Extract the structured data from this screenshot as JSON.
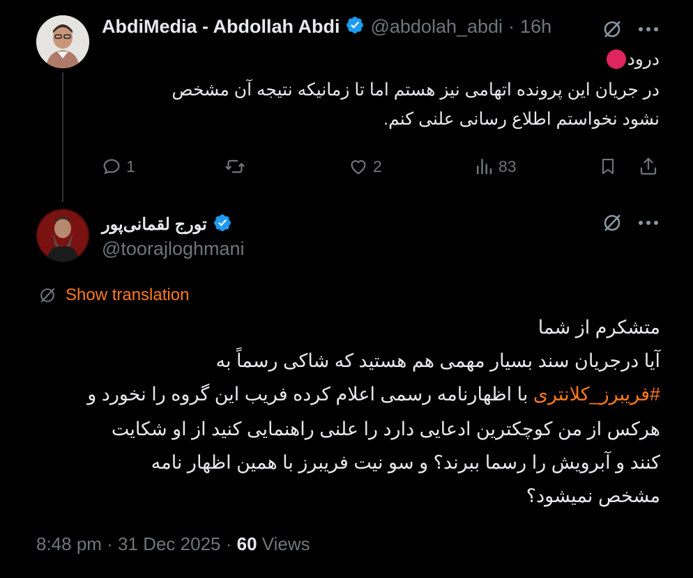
{
  "reply_tweet": {
    "display_name": "AbdiMedia - Abdollah Abdi",
    "handle": "@abdolah_abdi",
    "separator": "·",
    "time": "16h",
    "greeting": "درود",
    "body_line1": "در جریان این پرونده اتهامی نیز هستم اما تا زمانیکه نتیجه آن مشخص",
    "body_line2": "نشود نخواستم  اطلاع رسانی علنی کنم.",
    "replies": "1",
    "reposts": "",
    "likes": "2",
    "views": "83"
  },
  "main_tweet": {
    "display_name": "تورج لقمانی‌پور",
    "handle": "@toorajloghmani",
    "show_translation": "Show translation",
    "line1": "متشکرم از شما",
    "line2": "آیا درجریان سند بسیار مهمی هم هستید که شاکی رسماً به",
    "line3_hashtag": "#فریبرز_کلانتری",
    "line3_rest": " با اظهارنامه رسمی اعلام کرده فریب این گروه را نخورد و",
    "line4": "هرکس از من کوچکترین ادعایی دارد را علنی  راهنمایی کنید از او شکایت",
    "line5": "کنند و آبرویش را رسما ببرند؟ و سو نیت فریبرز با همین اظهار نامه",
    "line6": "مشخص نمیشود؟",
    "timestamp": "8:48 pm · 31 Dec 2025 · ",
    "views_count": "60",
    "views_label": " Views"
  },
  "colors": {
    "background": "#000000",
    "text": "#e7e9ea",
    "muted": "#71767b",
    "accent": "#ff7a1a",
    "verified": "#1d9bf0",
    "greeting_dot": "#e0245e"
  },
  "icons": [
    "grok-icon",
    "more-icon",
    "reply-icon",
    "repost-icon",
    "like-icon",
    "views-icon",
    "bookmark-icon",
    "share-icon",
    "verified-icon",
    "translate-icon"
  ]
}
